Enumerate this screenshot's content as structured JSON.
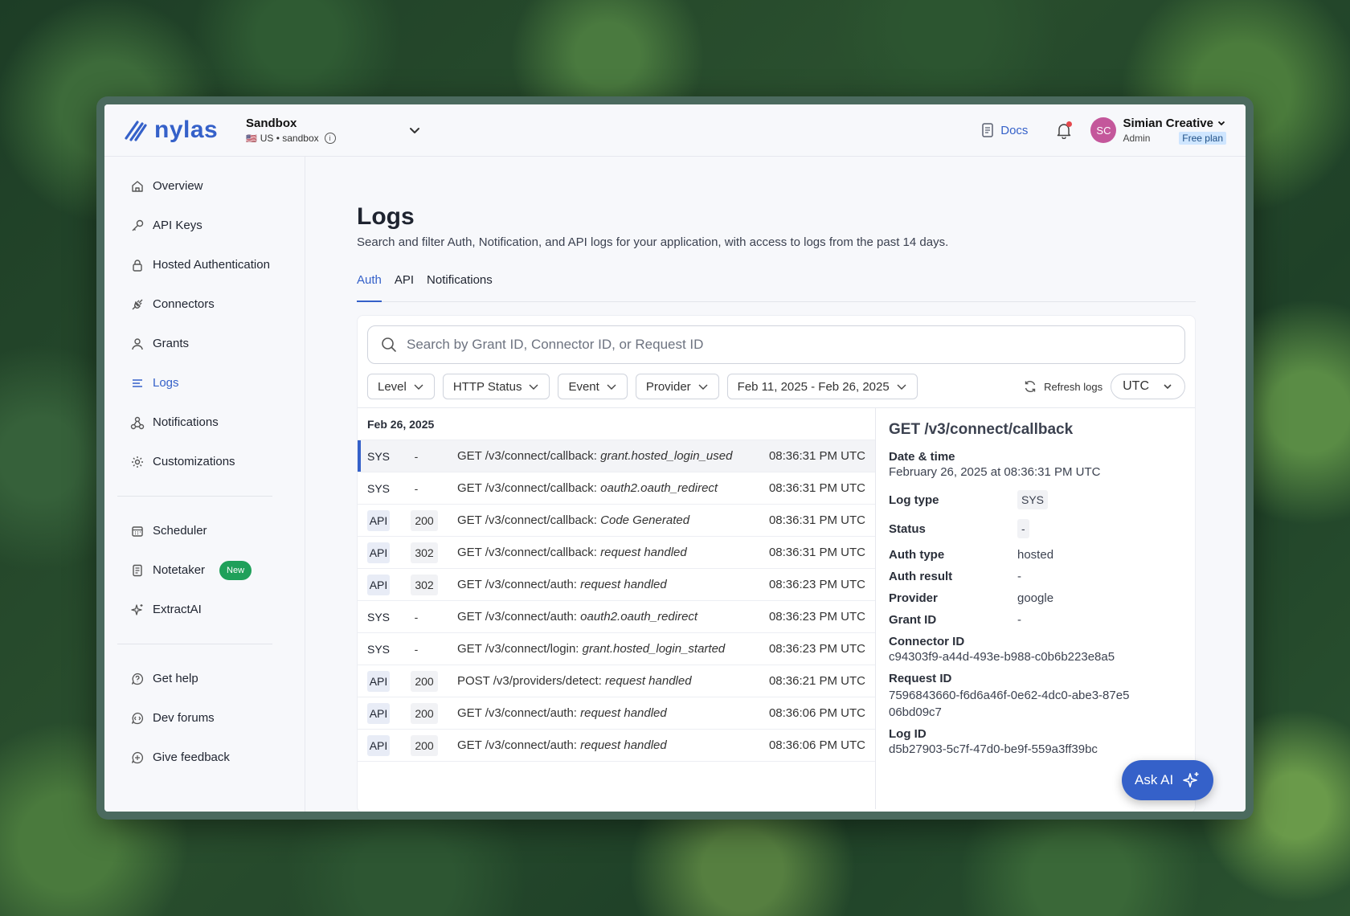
{
  "header": {
    "logo_text": "nylas",
    "env_name": "Sandbox",
    "env_flag": "🇺🇸",
    "env_region": "US • sandbox",
    "docs_label": "Docs",
    "user_initials": "SC",
    "user_name": "Simian Creative",
    "user_role": "Admin",
    "user_plan": "Free plan"
  },
  "sidebar": {
    "items": [
      {
        "label": "Overview",
        "icon": "home-icon"
      },
      {
        "label": "API Keys",
        "icon": "key-icon"
      },
      {
        "label": "Hosted Authentication",
        "icon": "lock-icon"
      },
      {
        "label": "Connectors",
        "icon": "plug-icon"
      },
      {
        "label": "Grants",
        "icon": "user-icon"
      },
      {
        "label": "Logs",
        "icon": "lines-icon"
      },
      {
        "label": "Notifications",
        "icon": "webhook-icon"
      },
      {
        "label": "Customizations",
        "icon": "gear-icon"
      }
    ],
    "items2": [
      {
        "label": "Scheduler",
        "icon": "calendar-icon"
      },
      {
        "label": "Notetaker",
        "icon": "notes-icon",
        "badge": "New"
      },
      {
        "label": "ExtractAI",
        "icon": "sparkle-icon"
      }
    ],
    "items3": [
      {
        "label": "Get help",
        "icon": "help-icon"
      },
      {
        "label": "Dev forums",
        "icon": "forum-icon"
      },
      {
        "label": "Give feedback",
        "icon": "feedback-icon"
      }
    ]
  },
  "main": {
    "title": "Logs",
    "description": "Search and filter Auth, Notification, and API logs for your application, with access to logs from the past 14 days.",
    "tabs": [
      "Auth",
      "API",
      "Notifications"
    ],
    "search_placeholder": "Search by Grant ID, Connector ID, or Request ID",
    "filters": [
      "Level",
      "HTTP Status",
      "Event",
      "Provider",
      "Feb 11, 2025 - Feb 26, 2025"
    ],
    "refresh_label": "Refresh logs",
    "timezone": "UTC",
    "date_heading": "Feb 26, 2025",
    "rows": [
      {
        "type": "SYS",
        "code": "-",
        "path": "GET /v3/connect/callback: ",
        "event": "grant.hosted_login_used",
        "time": "08:36:31 PM UTC"
      },
      {
        "type": "SYS",
        "code": "-",
        "path": "GET /v3/connect/callback: ",
        "event": "oauth2.oauth_redirect",
        "time": "08:36:31 PM UTC"
      },
      {
        "type": "API",
        "code": "200",
        "path": "GET /v3/connect/callback: ",
        "event": "Code Generated",
        "time": "08:36:31 PM UTC"
      },
      {
        "type": "API",
        "code": "302",
        "path": "GET /v3/connect/callback: ",
        "event": "request handled",
        "time": "08:36:31 PM UTC"
      },
      {
        "type": "API",
        "code": "302",
        "path": "GET /v3/connect/auth: ",
        "event": "request handled",
        "time": "08:36:23 PM UTC"
      },
      {
        "type": "SYS",
        "code": "-",
        "path": "GET /v3/connect/auth: ",
        "event": "oauth2.oauth_redirect",
        "time": "08:36:23 PM UTC"
      },
      {
        "type": "SYS",
        "code": "-",
        "path": "GET /v3/connect/login: ",
        "event": "grant.hosted_login_started",
        "time": "08:36:23 PM UTC"
      },
      {
        "type": "API",
        "code": "200",
        "path": "POST /v3/providers/detect: ",
        "event": "request handled",
        "time": "08:36:21 PM UTC"
      },
      {
        "type": "API",
        "code": "200",
        "path": "GET /v3/connect/auth: ",
        "event": "request handled",
        "time": "08:36:06 PM UTC"
      },
      {
        "type": "API",
        "code": "200",
        "path": "GET /v3/connect/auth: ",
        "event": "request handled",
        "time": "08:36:06 PM UTC"
      }
    ]
  },
  "detail": {
    "title": "GET /v3/connect/callback",
    "datetime_label": "Date & time",
    "datetime_value": "February 26, 2025 at 08:36:31 PM UTC",
    "log_type_label": "Log type",
    "log_type_value": "SYS",
    "status_label": "Status",
    "status_value": "-",
    "auth_type_label": "Auth type",
    "auth_type_value": "hosted",
    "auth_result_label": "Auth result",
    "auth_result_value": "-",
    "provider_label": "Provider",
    "provider_value": "google",
    "grant_id_label": "Grant ID",
    "grant_id_value": "-",
    "connector_id_label": "Connector ID",
    "connector_id_value": "c94303f9-a44d-493e-b988-c0b6b223e8a5",
    "request_id_label": "Request ID",
    "request_id_value": "7596843660-f6d6a46f-0e62-4dc0-abe3-87e506bd09c7",
    "log_id_label": "Log ID",
    "log_id_value": "d5b27903-5c7f-47d0-be9f-559a3ff39bc"
  },
  "ask_ai_label": "Ask AI",
  "colors": {
    "accent": "#3561c9",
    "badge_new": "#1fa05a",
    "avatar": "#c4579b"
  }
}
